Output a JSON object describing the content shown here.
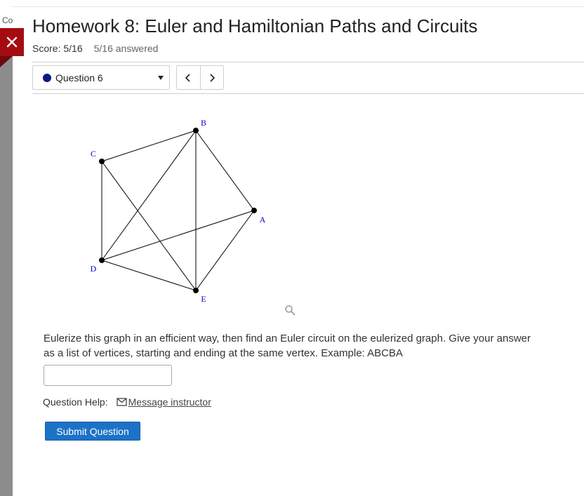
{
  "background_page": {
    "clipped_text": "Co"
  },
  "header": {
    "title": "Homework 8: Euler and Hamiltonian Paths and Circuits",
    "score": "Score: 5/16",
    "answered": "5/16 answered"
  },
  "close_button": {
    "icon": "close-icon"
  },
  "question_selector": {
    "label": "Question 6",
    "status_color": "#0a1a80"
  },
  "navigation": {
    "prev_icon": "chevron-left-icon",
    "next_icon": "chevron-right-icon"
  },
  "graph": {
    "vertices": [
      "A",
      "B",
      "C",
      "D",
      "E"
    ],
    "edges": [
      [
        "C",
        "B"
      ],
      [
        "B",
        "A"
      ],
      [
        "A",
        "E"
      ],
      [
        "B",
        "E"
      ],
      [
        "B",
        "D"
      ],
      [
        "C",
        "D"
      ],
      [
        "C",
        "E"
      ],
      [
        "D",
        "A"
      ],
      [
        "D",
        "E"
      ]
    ],
    "label_color": "#0000cc",
    "zoom_icon": "magnifier-icon"
  },
  "question": {
    "text": "Eulerize this graph in an efficient way, then find an Euler circuit on the eulerized graph. Give your answer as a list of vertices, starting and ending at the same vertex. Example: ABCBA",
    "input_value": "",
    "input_placeholder": ""
  },
  "help": {
    "label": "Question Help:",
    "link_text": "Message instructor",
    "link_icon": "mail-icon"
  },
  "actions": {
    "submit_label": "Submit Question",
    "submit_color": "#1c72c6"
  }
}
